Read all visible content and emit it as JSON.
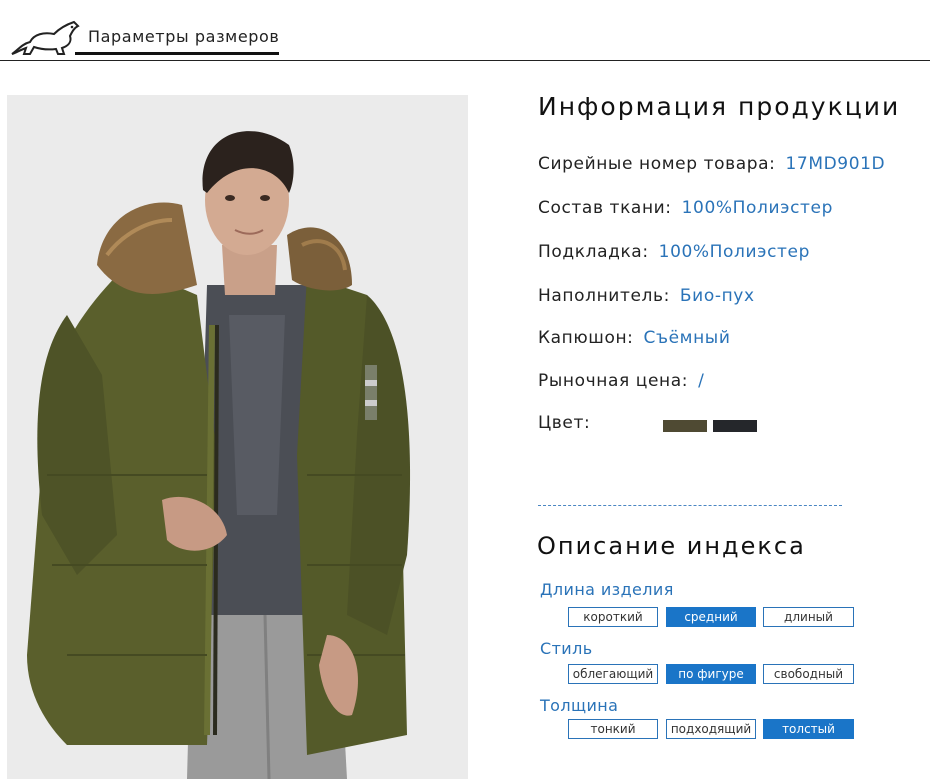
{
  "header": {
    "title": "Параметры размеров"
  },
  "info": {
    "title": "Информация продукции",
    "rows": [
      {
        "label": "Сирейные номер товара:",
        "value": "17MD901D"
      },
      {
        "label": "Состав ткани:",
        "value": "100%Полиэстер"
      },
      {
        "label": "Подкладка:",
        "value": "100%Полиэстер"
      },
      {
        "label": "Наполнитель:",
        "value": "Био-пух"
      },
      {
        "label": "Капюшон:",
        "value": "Съёмный"
      },
      {
        "label": "Рыночная цена:",
        "value": "/"
      }
    ],
    "color_label": "Цвет:",
    "colors": [
      "#4f4a33",
      "#25272b"
    ]
  },
  "index": {
    "title": "Описание индекса",
    "categories": [
      {
        "name": "Длина изделия",
        "options": [
          "короткий",
          "средний",
          "длиный"
        ],
        "selected": 1
      },
      {
        "name": "Стиль",
        "options": [
          "облегающий",
          "по фигуре",
          "свободный"
        ],
        "selected": 1
      },
      {
        "name": "Толщина",
        "options": [
          "тонкий",
          "подходящий",
          "толстый"
        ],
        "selected": 2
      }
    ]
  },
  "accent": "#1a75c8",
  "logo_icon": "bear-icon",
  "photo": "man-in-olive-parka-with-fur-hood"
}
